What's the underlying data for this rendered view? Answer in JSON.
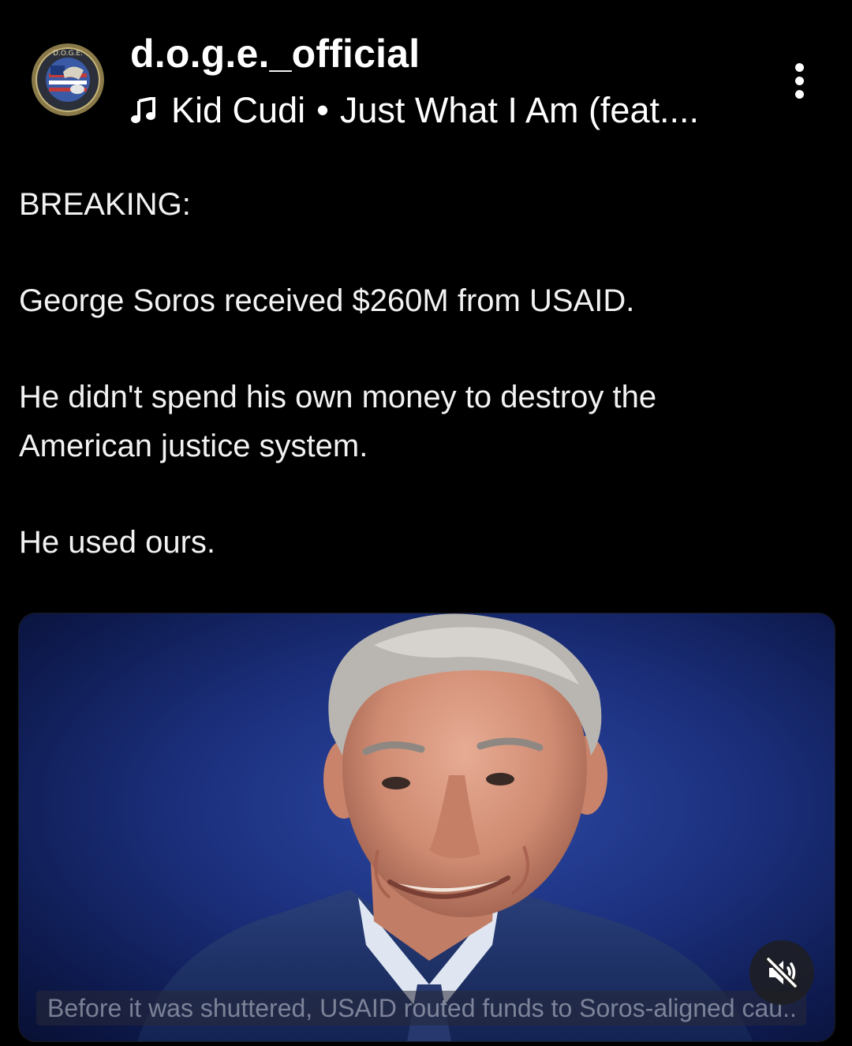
{
  "post": {
    "account": {
      "username": "d.o.g.e._official",
      "avatar_icon": "doge-seal-logo-icon",
      "avatar_logo_text": "D.O.G.E."
    },
    "music": {
      "icon": "music-note-icon",
      "artist": "Kid Cudi",
      "separator": "•",
      "title": "Just What I Am (feat...."
    },
    "more_icon": "vertical-ellipsis-icon",
    "caption": {
      "heading": "BREAKING:",
      "line1": "George Soros received $260M from USAID.",
      "line2a": "He didn't spend his own money to destroy the",
      "line2b": "American justice system.",
      "line3": "He used ours."
    },
    "media": {
      "subtitle": "Before it was shuttered, USAID routed funds to Soros-aligned cau...",
      "mute_icon": "speaker-muted-icon"
    }
  },
  "colors": {
    "background": "#000000",
    "text": "#f2f2f2",
    "photo_backdrop": "#1b2f7c"
  }
}
